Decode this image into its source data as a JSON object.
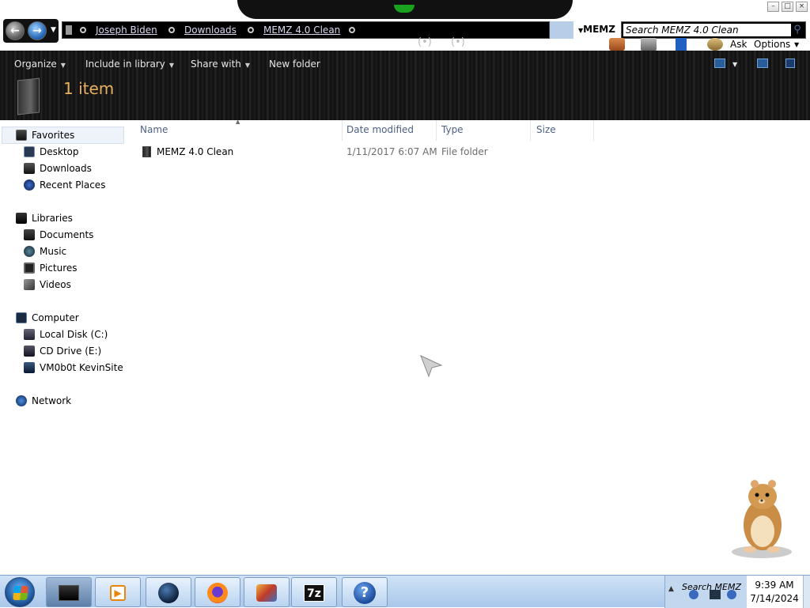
{
  "address_bar": {
    "segments": [
      "Joseph Biden",
      "Downloads",
      "MEMZ 4.0 Clean"
    ],
    "refresh_label": "MEMZ"
  },
  "search": {
    "value": "Search MEMZ 4.0 Clean"
  },
  "menu_extra": {
    "ask": "Ask",
    "options": "Options"
  },
  "toolbar": {
    "organize": "Organize",
    "include_in_library": "Include in library",
    "share_with": "Share with",
    "new_folder": "New folder",
    "item_count": "1 item"
  },
  "navigation": {
    "favorites": {
      "label": "Favorites",
      "items": [
        "Desktop",
        "Downloads",
        "Recent Places"
      ]
    },
    "libraries": {
      "label": "Libraries",
      "items": [
        "Documents",
        "Music",
        "Pictures",
        "Videos"
      ]
    },
    "computer": {
      "label": "Computer",
      "items": [
        "Local Disk (C:)",
        "CD Drive (E:)",
        "VM0b0t KevinSite"
      ]
    },
    "network": {
      "label": "Network"
    }
  },
  "file_list": {
    "columns": [
      "Name",
      "Date modified",
      "Type",
      "Size"
    ],
    "rows": [
      {
        "name": "MEMZ 4.0 Clean",
        "date_modified": "1/11/2017 6:07 AM",
        "type": "File folder",
        "size": ""
      }
    ]
  },
  "taskbar": {
    "apps": [
      "explorer-icon",
      "media-player-icon",
      "globe-icon",
      "firefox-icon",
      "paint-icon",
      "7zip-icon",
      "help-icon"
    ],
    "seven_zip_label": "7z",
    "help_label": "?",
    "tray_search": "Search MEMZ",
    "time": "9:39 AM",
    "date": "7/14/2024"
  },
  "colors": {
    "toolbar_bg": "#111111",
    "item_count": "#e8b060",
    "column_header": "#4d6185",
    "taskbar": "#b9d3ef"
  }
}
